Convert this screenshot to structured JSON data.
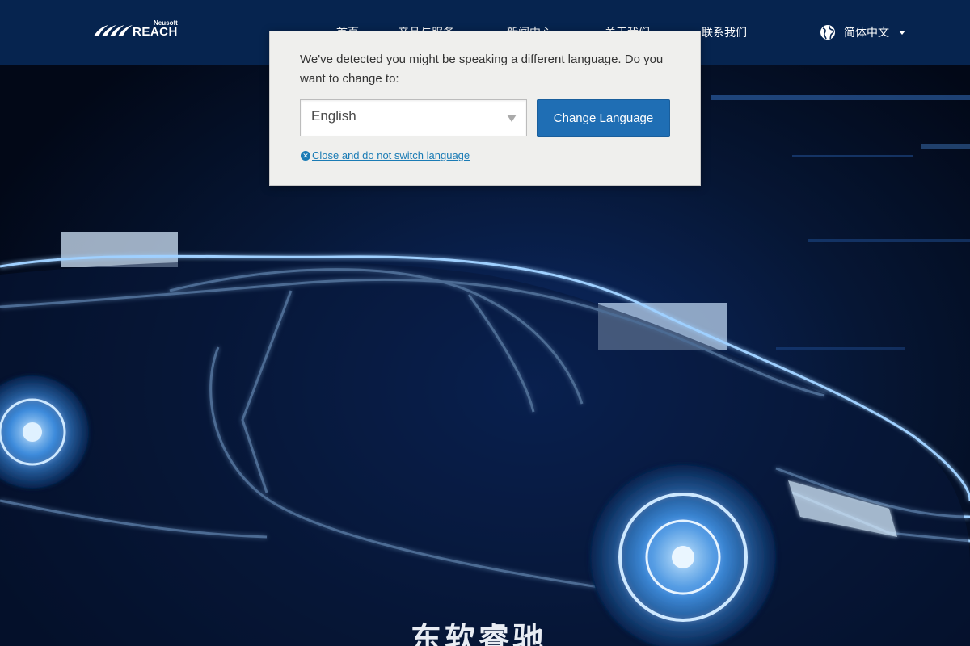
{
  "header": {
    "logo_small": "Neusoft",
    "logo_text": "REACH",
    "nav": [
      "首页",
      "产品与服务",
      "新闻中心",
      "关于我们",
      "联系我们"
    ],
    "language_label": "简体中文"
  },
  "dialog": {
    "message": "We've detected you might be speaking a different language. Do you want to change to:",
    "select_value": "English",
    "change_button": "Change Language",
    "close_label": "Close and do not switch language"
  },
  "hero": {
    "title": "东软睿驰"
  },
  "icons": {
    "globe": "globe-icon",
    "caret": "caret-down-icon",
    "close": "close-circle-icon",
    "select_arrow": "dropdown-arrow-icon"
  },
  "colors": {
    "navbar": "#06244f",
    "button": "#1f6eb4",
    "link": "#1a7bb5",
    "dialog_bg": "#efefed"
  }
}
